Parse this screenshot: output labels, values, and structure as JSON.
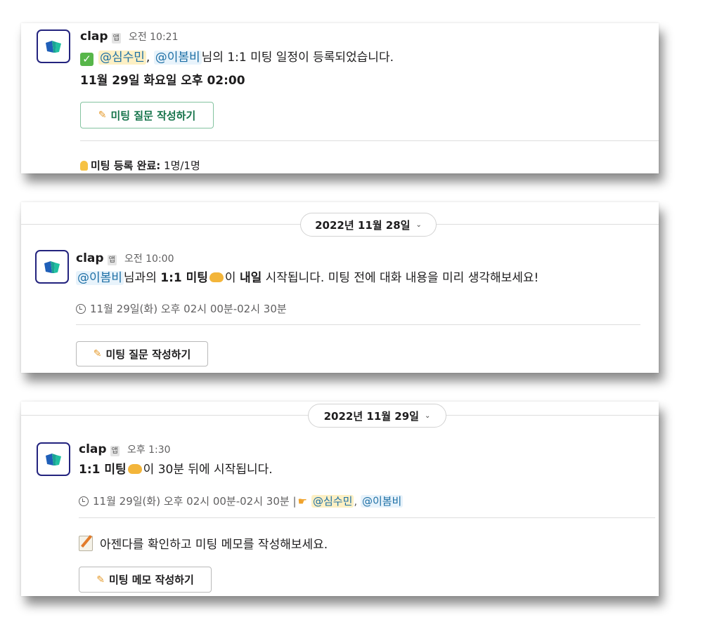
{
  "brand": {
    "name": "clap",
    "tag": "앱",
    "logo_color": "#23237e",
    "accent_green": "#1fb8a8"
  },
  "messages": [
    {
      "time": "오전 10:21",
      "mention_1": "@심수민",
      "sep": ",",
      "mention_2": "@이봄비",
      "text_after": "님의 1:1 미팅 일정이 등록되었습니다.",
      "schedule": "11월 29일 화요일 오후 02:00",
      "button": "미팅 질문 작성하기",
      "status_label": "미팅 등록 완료:",
      "status_value": "1명/1명",
      "icons": [
        "check-icon",
        "pencil-icon",
        "bulb-icon"
      ]
    },
    {
      "date": "2022년 11월 28일",
      "time": "오전 10:00",
      "mention": "@이봄비",
      "t1": "님과의",
      "t2": "1:1 미팅",
      "t3": "이",
      "t4": "내일",
      "t5": "시작됩니다. 미팅 전에 대화 내용을 미리 생각해보세요!",
      "when": "11월 29일(화) 오후 02시 00분-02시 30분",
      "button": "미팅 질문 작성하기",
      "icons": [
        "handshake-icon",
        "clock-icon",
        "pencil-icon"
      ]
    },
    {
      "date": "2022년 11월 29일",
      "time": "오후 1:30",
      "t1": "1:1 미팅",
      "t2": "이 30분 뒤에 시작됩니다.",
      "when": "11월 29일(화) 오후 02시 00분-02시 30분 |",
      "mention_1": "@심수민",
      "sep": ",",
      "mention_2": "@이봄비",
      "memo_text": "아젠다를 확인하고 미팅 메모를 작성해보세요.",
      "button": "미팅 메모 작성하기",
      "icons": [
        "handshake-icon",
        "clock-icon",
        "pointing-hand-icon",
        "memo-icon",
        "pencil-icon"
      ]
    }
  ]
}
